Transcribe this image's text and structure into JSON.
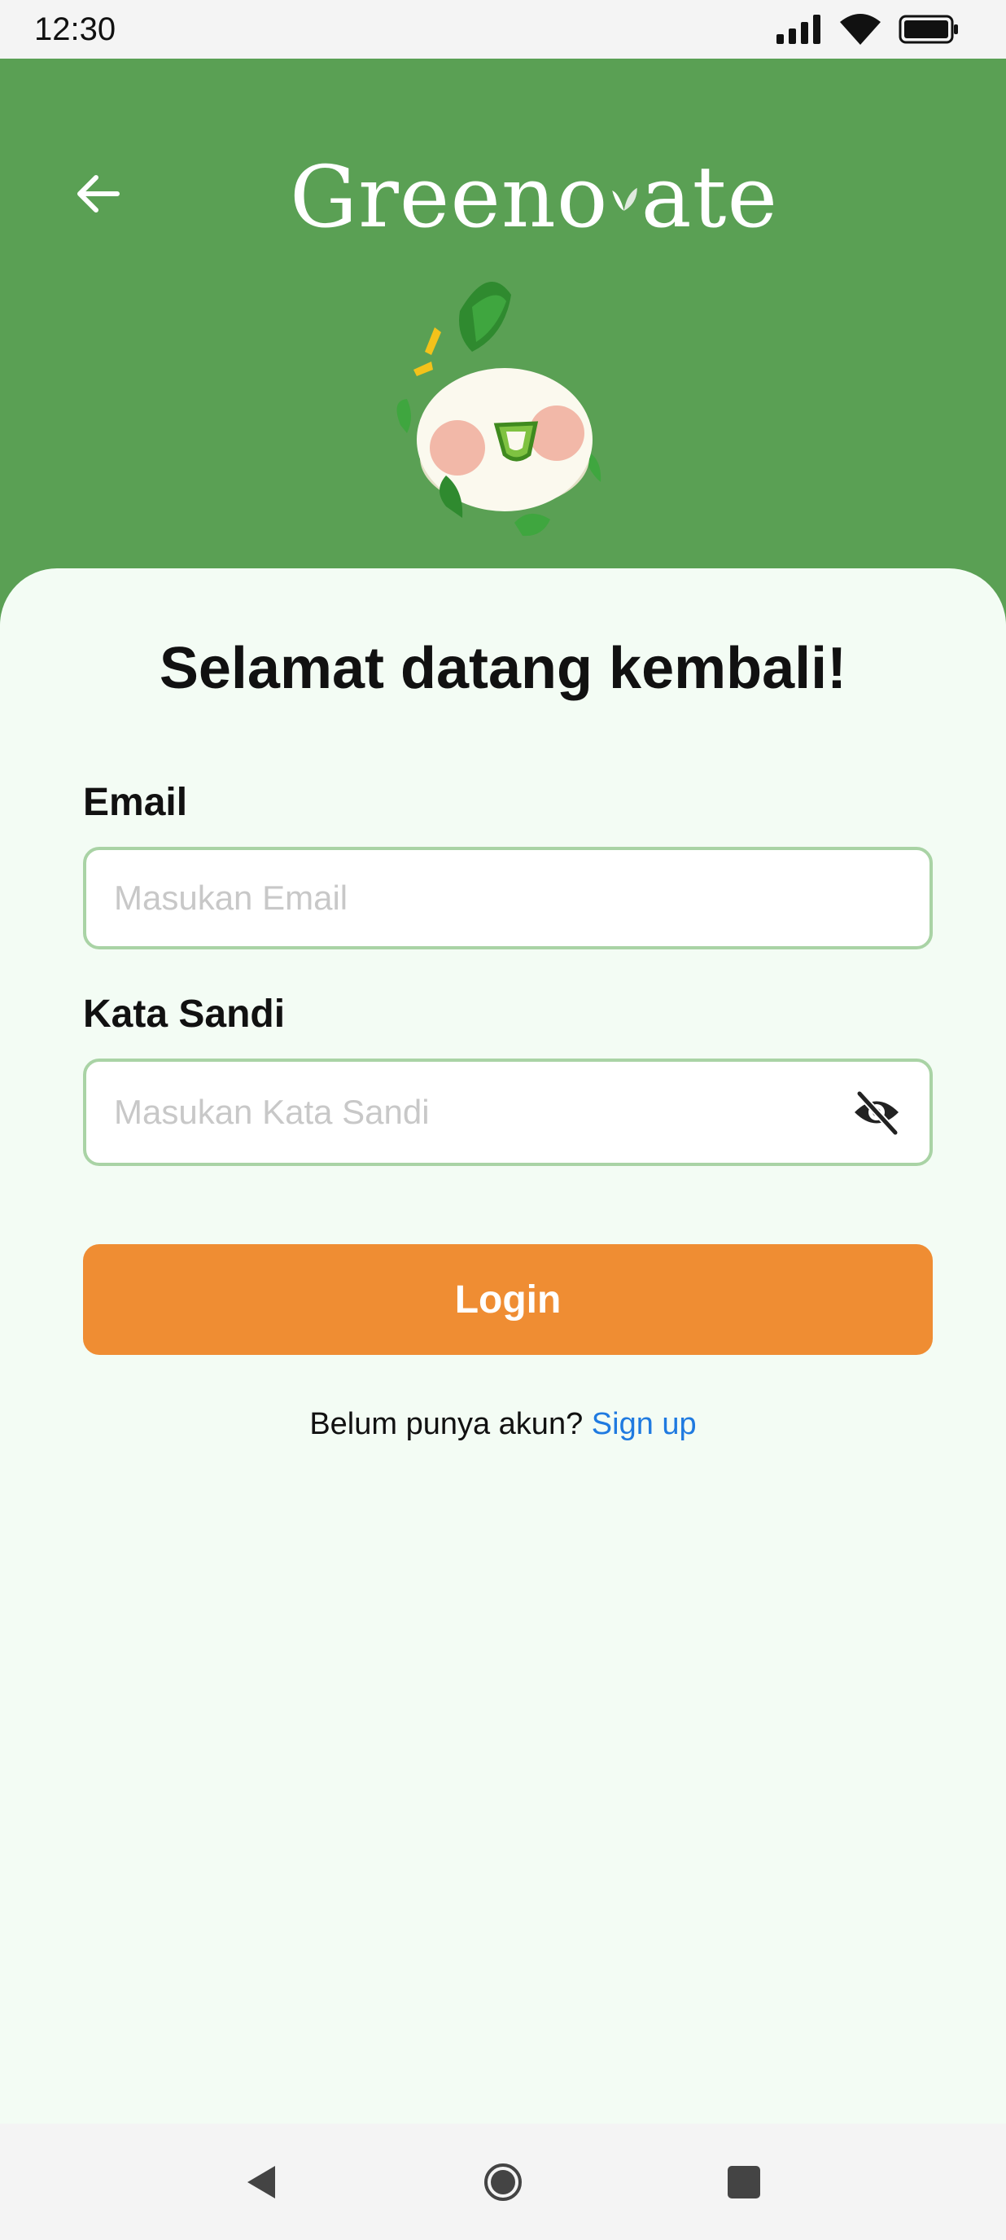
{
  "status_bar": {
    "time": "12:30",
    "icons": [
      "signal-icon",
      "wifi-icon",
      "battery-icon"
    ]
  },
  "header": {
    "back_icon": "arrow-left-icon",
    "logo_text_start": "Greeno",
    "logo_text_end": "ate",
    "background_color": "#5aa054"
  },
  "login": {
    "title": "Selamat datang kembali!",
    "email_label": "Email",
    "email_placeholder": "Masukan Email",
    "email_value": "",
    "password_label": "Kata Sandi",
    "password_placeholder": "Masukan Kata Sandi",
    "password_value": "",
    "password_toggle_icon": "eye-off-icon",
    "login_button": "Login",
    "login_button_color": "#ef8d33",
    "signup_prompt": "Belum punya akun?",
    "signup_link": "Sign up",
    "link_color": "#1f7ae0"
  },
  "nav_bar": {
    "icons": [
      "nav-back-icon",
      "nav-home-icon",
      "nav-recents-icon"
    ]
  }
}
